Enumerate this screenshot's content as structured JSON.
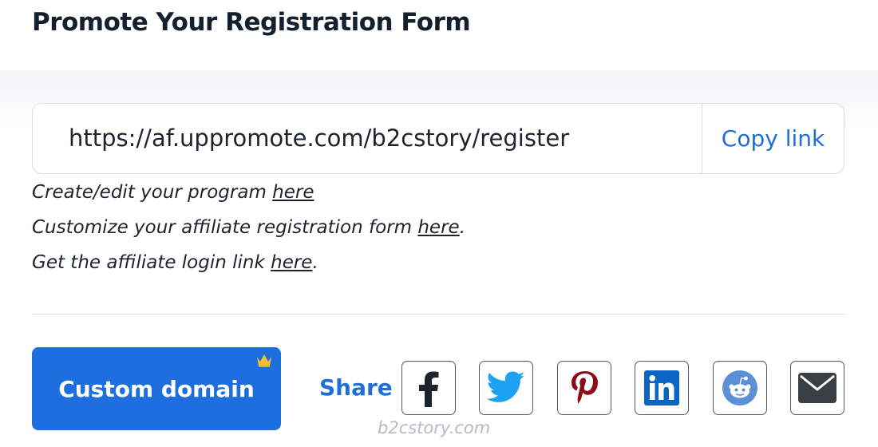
{
  "header": {
    "title": "Promote Your Registration Form"
  },
  "link_box": {
    "url": "https://af.uppromote.com/b2cstory/register",
    "copy_label": "Copy link"
  },
  "info": [
    {
      "text": "Create/edit your program ",
      "link": "here",
      "suffix": ""
    },
    {
      "text": "Customize your affiliate registration form ",
      "link": "here",
      "suffix": "."
    },
    {
      "text": "Get the affiliate login link ",
      "link": "here",
      "suffix": "."
    }
  ],
  "custom_domain": {
    "label": "Custom domain",
    "badge_icon": "crown-icon"
  },
  "share": {
    "label": "Share",
    "buttons": [
      {
        "name": "facebook",
        "icon": "facebook-icon",
        "color": "#1c2430"
      },
      {
        "name": "twitter",
        "icon": "twitter-icon",
        "color": "#1da1f2"
      },
      {
        "name": "pinterest",
        "icon": "pinterest-icon",
        "color": "#8c0b16"
      },
      {
        "name": "linkedin",
        "icon": "linkedin-icon",
        "color": "#0a66c2"
      },
      {
        "name": "reddit",
        "icon": "reddit-icon",
        "color": "#5b8fd6"
      },
      {
        "name": "email",
        "icon": "email-icon",
        "color": "#3a3f45"
      }
    ]
  },
  "watermark": "b2cstory.com",
  "colors": {
    "accent": "#1d6fe0",
    "link": "#1f6fd6",
    "text": "#1c2430"
  }
}
